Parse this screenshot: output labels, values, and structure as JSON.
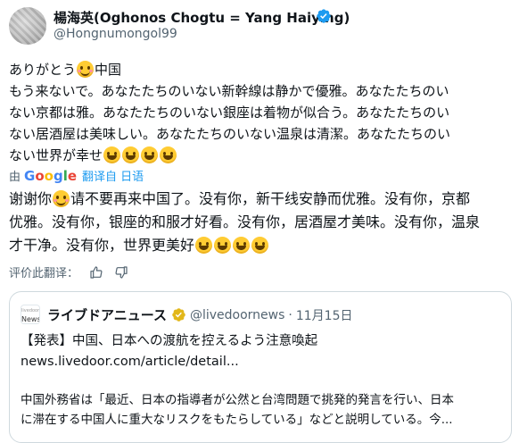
{
  "author": {
    "display_name": "楊海英(Oghonos Chogtu = Yang Haiying)",
    "handle": "@Hongnumongol99",
    "verified_color": "#1d9bf0"
  },
  "original_text": {
    "line1_a": "ありがとう",
    "line1_b": "中国",
    "line2": "もう来ないで。あなたたちのいない新幹線は静かで優雅。あなたたちのい",
    "line3": "ない京都は雅。あなたたちのいない銀座は着物が似合う。あなたたちのい",
    "line4": "ない居酒屋は美味しい。あなたたちのいない温泉は清潔。あなたたちのい",
    "line5": "ない世界が幸せ"
  },
  "translation_bar": {
    "by_label": "由",
    "google_letters": [
      "G",
      "o",
      "o",
      "g",
      "l",
      "e"
    ],
    "translated_from": "翻译自 日语"
  },
  "translated_text": {
    "line1_a": "谢谢你",
    "line1_b": "请不要再来中国了。没有你，新干线安静而优雅。没有你，京都",
    "line2": "优雅。没有你，银座的和服才好看。没有你，居酒屋才美味。没有你，温泉",
    "line3": "才干净。没有你，世界更美好"
  },
  "rate_translation": {
    "label": "评价此翻译：",
    "icons": [
      "thumbs-up-icon",
      "thumbs-down-icon"
    ]
  },
  "quoted_post": {
    "avatar_text": "News",
    "avatar_sub": "livedoor",
    "name": "ライブドアニュース",
    "handle": "@livedoornews",
    "separator": "·",
    "date": "11月15日",
    "headline": "【発表】中国、日本への渡航を控えるよう注意喚起",
    "link": "news.livedoor.com/article/detail...",
    "body_line1": "中国外務省は「最近、日本の指導者が公然と台湾問題で挑発的発言を行い、日本",
    "body_line2": "に滞在する中国人に重大なリスクをもたらしている」などと説明している。今...",
    "gold_badge_color": "#e2b719"
  }
}
